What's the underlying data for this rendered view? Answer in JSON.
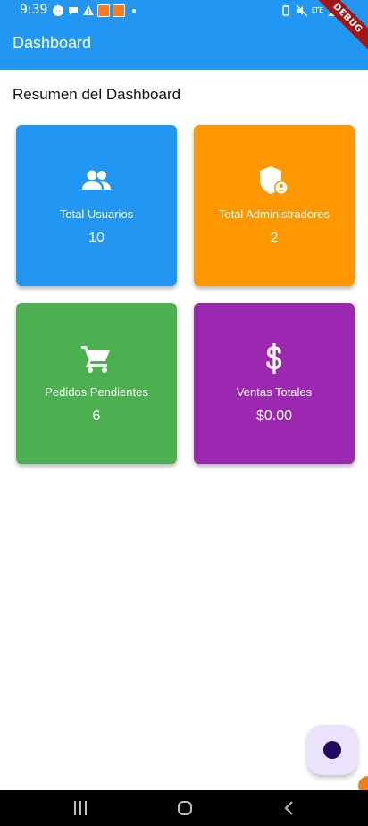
{
  "status_bar": {
    "time": "9:39",
    "network": "LTE"
  },
  "debug_banner": "DEBUG",
  "app_bar": {
    "title": "Dashboard",
    "color": "#2196f3"
  },
  "section_title": "Resumen del Dashboard",
  "cards": [
    {
      "label": "Total Usuarios",
      "value": "10",
      "icon": "group-icon",
      "color": "#2196f3"
    },
    {
      "label": "Total Administradores",
      "value": "2",
      "icon": "admin-shield-icon",
      "color": "#ff9800"
    },
    {
      "label": "Pedidos Pendientes",
      "value": "6",
      "icon": "shopping-cart-icon",
      "color": "#4caf50"
    },
    {
      "label": "Ventas Totales",
      "value": "$0.00",
      "icon": "dollar-icon",
      "color": "#9c27b0"
    }
  ],
  "fab": {
    "icon": "dot-icon",
    "color": "#ebe2fb"
  },
  "nav_bar": {
    "buttons": [
      "recent-apps-icon",
      "home-icon",
      "back-icon"
    ]
  }
}
